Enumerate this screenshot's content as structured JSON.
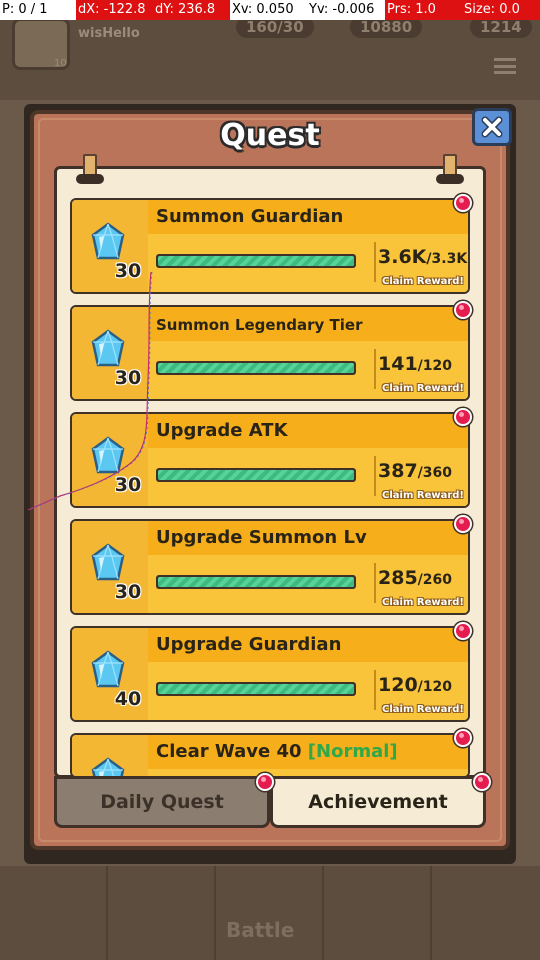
{
  "debug": {
    "p": "P: 0 / 1",
    "dx": "dX: -122.8",
    "dy": "dY: 236.8",
    "xv": "Xv: 0.050",
    "yv": "Yv: -0.006",
    "prs": "Prs: 1.0",
    "size": "Size: 0.0"
  },
  "background": {
    "player_name": "wisHello",
    "player_level": "10",
    "resource_1": "160/30",
    "resource_2": "10880",
    "resource_3": "1214",
    "battle_label": "Battle"
  },
  "dialog": {
    "title": "Quest",
    "close_icon": "close-x-icon"
  },
  "quests": [
    {
      "name": "Summon Guardian",
      "reward": "30",
      "current": "3.6K",
      "target": "3.3K",
      "progress": 1.0,
      "status": "Claim Reward!"
    },
    {
      "name": "Summon Legendary Tier",
      "reward": "30",
      "current": "141",
      "target": "120",
      "progress": 1.0,
      "status": "Claim Reward!"
    },
    {
      "name": "Upgrade ATK",
      "reward": "30",
      "current": "387",
      "target": "360",
      "progress": 1.0,
      "status": "Claim Reward!"
    },
    {
      "name": "Upgrade Summon Lv",
      "reward": "30",
      "current": "285",
      "target": "260",
      "progress": 1.0,
      "status": "Claim Reward!"
    },
    {
      "name": "Upgrade Guardian",
      "reward": "40",
      "current": "120",
      "target": "120",
      "progress": 1.0,
      "status": "Claim Reward!"
    },
    {
      "name": "Clear Wave 40",
      "tag": "[Normal]",
      "reward": "",
      "current": "",
      "target": "",
      "progress": 1.0,
      "status": ""
    }
  ],
  "tabs": {
    "daily": "Daily Quest",
    "achievement": "Achievement",
    "active": "achievement"
  },
  "colors": {
    "reward_gem": "#5bc8f2",
    "progress_fill": "#3dba7f",
    "notification": "#e51d4e",
    "tag_green": "#2ea84a"
  }
}
